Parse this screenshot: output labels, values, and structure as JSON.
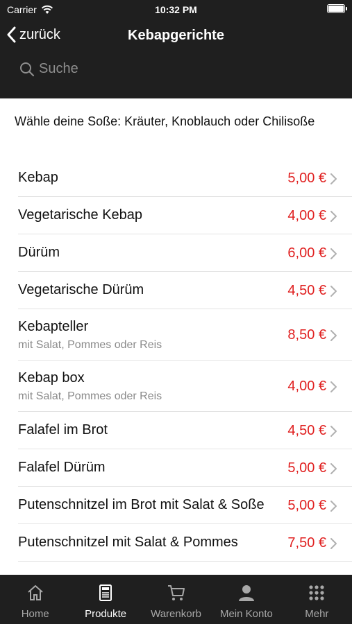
{
  "status": {
    "carrier": "Carrier",
    "time": "10:32 PM"
  },
  "nav": {
    "back_label": "zurück",
    "title": "Kebapgerichte"
  },
  "search": {
    "placeholder": "Suche"
  },
  "intro": "Wähle deine Soße: Kräuter, Knoblauch oder Chilisoße",
  "items": [
    {
      "name": "Kebap",
      "price": "5,00 €"
    },
    {
      "name": "Vegetarische Kebap",
      "price": "4,00 €"
    },
    {
      "name": "Dürüm",
      "price": "6,00 €"
    },
    {
      "name": "Vegetarische Dürüm",
      "price": "4,50 €"
    },
    {
      "name": "Kebapteller",
      "desc": "mit Salat, Pommes oder Reis",
      "price": "8,50 €"
    },
    {
      "name": "Kebap box",
      "desc": "mit Salat, Pommes oder Reis",
      "price": "4,00 €"
    },
    {
      "name": "Falafel im Brot",
      "price": "4,50 €"
    },
    {
      "name": "Falafel Dürüm",
      "price": "5,00 €"
    },
    {
      "name": "Putenschnitzel im Brot mit Salat & Soße",
      "price": "5,00 €"
    },
    {
      "name": "Putenschnitzel mit Salat & Pommes",
      "price": "7,50 €"
    }
  ],
  "tabs": [
    {
      "label": "Home",
      "icon": "home-icon"
    },
    {
      "label": "Produkte",
      "icon": "menu-card-icon",
      "active": true
    },
    {
      "label": "Warenkorb",
      "icon": "cart-icon"
    },
    {
      "label": "Mein Konto",
      "icon": "person-icon"
    },
    {
      "label": "Mehr",
      "icon": "grid-dots-icon"
    }
  ],
  "colors": {
    "header": "#1f1f1f",
    "price": "#e02020"
  }
}
